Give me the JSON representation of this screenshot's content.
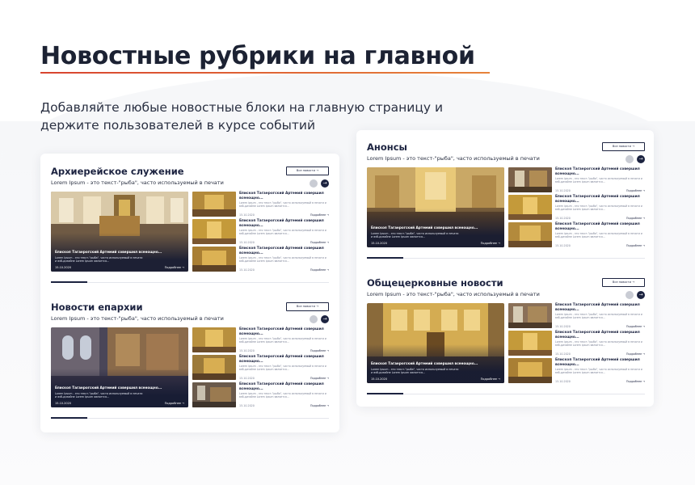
{
  "header": {
    "title": "Новостные рубрики на главной",
    "subtitle": "Добавляйте любые новостные блоки на главную страницу и держите пользователей в курсе событий"
  },
  "colors": {
    "navy": "#1c2340",
    "accent_start": "#d8442f",
    "accent_end": "#e6833a",
    "gold": "#c49a3a"
  },
  "common": {
    "section_sub": "Lorem Ipsum - это текст-\"рыба\", часто используемый в печати",
    "all_button": "Все новости  →",
    "next_icon": "→",
    "feature_title": "Епископ Таганрогский Артемий совершил всенощно...",
    "feature_text": "Lorem Ipsum - это текст-\"рыба\", часто используемый в печати и вэб-дизайне Lorem Ipsum является...",
    "date": "15.10.2020",
    "more": "Подробнее  →",
    "item_title": "Епископ Таганрогский Артемий совершил всенощно...",
    "item_text": "Lorem ipsum - это текст-\"рыба\", часто используемый в печати и вэб-дизайне Lorem ipsum является..."
  },
  "sections": [
    {
      "id": "archpastoral",
      "title": "Архиерейское служение"
    },
    {
      "id": "diocese",
      "title": "Новости епархии"
    },
    {
      "id": "announcements",
      "title": "Анонсы"
    },
    {
      "id": "church-news",
      "title": "Общецерковные новости"
    }
  ]
}
